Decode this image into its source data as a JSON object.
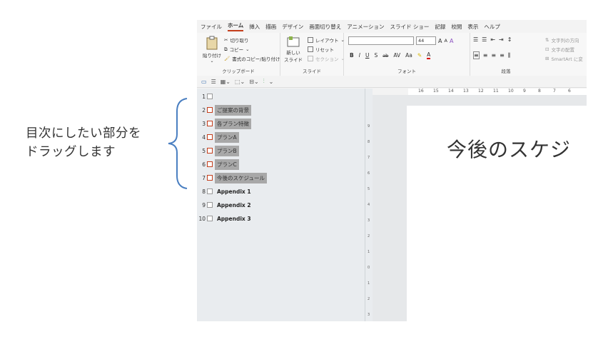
{
  "annotation": {
    "line1": "目次にしたい部分を",
    "line2": "ドラッグします"
  },
  "menu": {
    "tabs": [
      "ファイル",
      "ホーム",
      "挿入",
      "描画",
      "デザイン",
      "画面切り替え",
      "アニメーション",
      "スライド ショー",
      "記録",
      "校閲",
      "表示",
      "ヘルプ"
    ],
    "active": "ホーム"
  },
  "ribbon": {
    "clipboard": {
      "paste": "貼り付け",
      "cut": "切り取り",
      "copy": "コピー",
      "format_painter": "書式のコピー/貼り付け",
      "label": "クリップボード"
    },
    "slides": {
      "new_slide_line1": "新しい",
      "new_slide_line2": "スライド",
      "layout": "レイアウト",
      "reset": "リセット",
      "section": "セクション",
      "label": "スライド"
    },
    "font": {
      "size": "44",
      "bold": "B",
      "italic": "I",
      "underline": "U",
      "strike": "S",
      "abc": "ab",
      "spacing": "AV",
      "case": "Aa",
      "grow": "A",
      "shrink": "A",
      "label": "フォント"
    },
    "paragraph": {
      "label": "段落",
      "text_direction": "文字列の方向",
      "align_text": "文字の配置",
      "smartart": "SmartArt に変"
    }
  },
  "outline": {
    "items": [
      {
        "num": "1",
        "text": "",
        "selected": false,
        "highlight": false,
        "bold": false
      },
      {
        "num": "2",
        "text": "ご提案の背景",
        "selected": true,
        "highlight": true,
        "bold": false
      },
      {
        "num": "3",
        "text": "各プラン特徴",
        "selected": true,
        "highlight": true,
        "bold": false
      },
      {
        "num": "4",
        "text": "プランA",
        "selected": true,
        "highlight": true,
        "bold": false
      },
      {
        "num": "5",
        "text": "プランB",
        "selected": true,
        "highlight": true,
        "bold": false
      },
      {
        "num": "6",
        "text": "プランC",
        "selected": true,
        "highlight": true,
        "bold": false
      },
      {
        "num": "7",
        "text": "今後のスケジュール",
        "selected": true,
        "highlight": true,
        "bold": false
      },
      {
        "num": "8",
        "text": "Appendix 1",
        "selected": false,
        "highlight": false,
        "bold": true
      },
      {
        "num": "9",
        "text": "Appendix 2",
        "selected": false,
        "highlight": false,
        "bold": true
      },
      {
        "num": "10",
        "text": "Appendix 3",
        "selected": false,
        "highlight": false,
        "bold": true
      }
    ]
  },
  "hruler": [
    "16",
    "15",
    "14",
    "13",
    "12",
    "11",
    "10",
    "9",
    "8",
    "7",
    "6"
  ],
  "vruler": [
    "9",
    "8",
    "7",
    "6",
    "5",
    "4",
    "3",
    "2",
    "1",
    "0",
    "1",
    "2",
    "3",
    "4"
  ],
  "slide": {
    "title": "今後のスケジ"
  },
  "colors": {
    "accent": "#c43e1c",
    "highlight": "#a8a8a8",
    "brace": "#4a7fc1"
  }
}
